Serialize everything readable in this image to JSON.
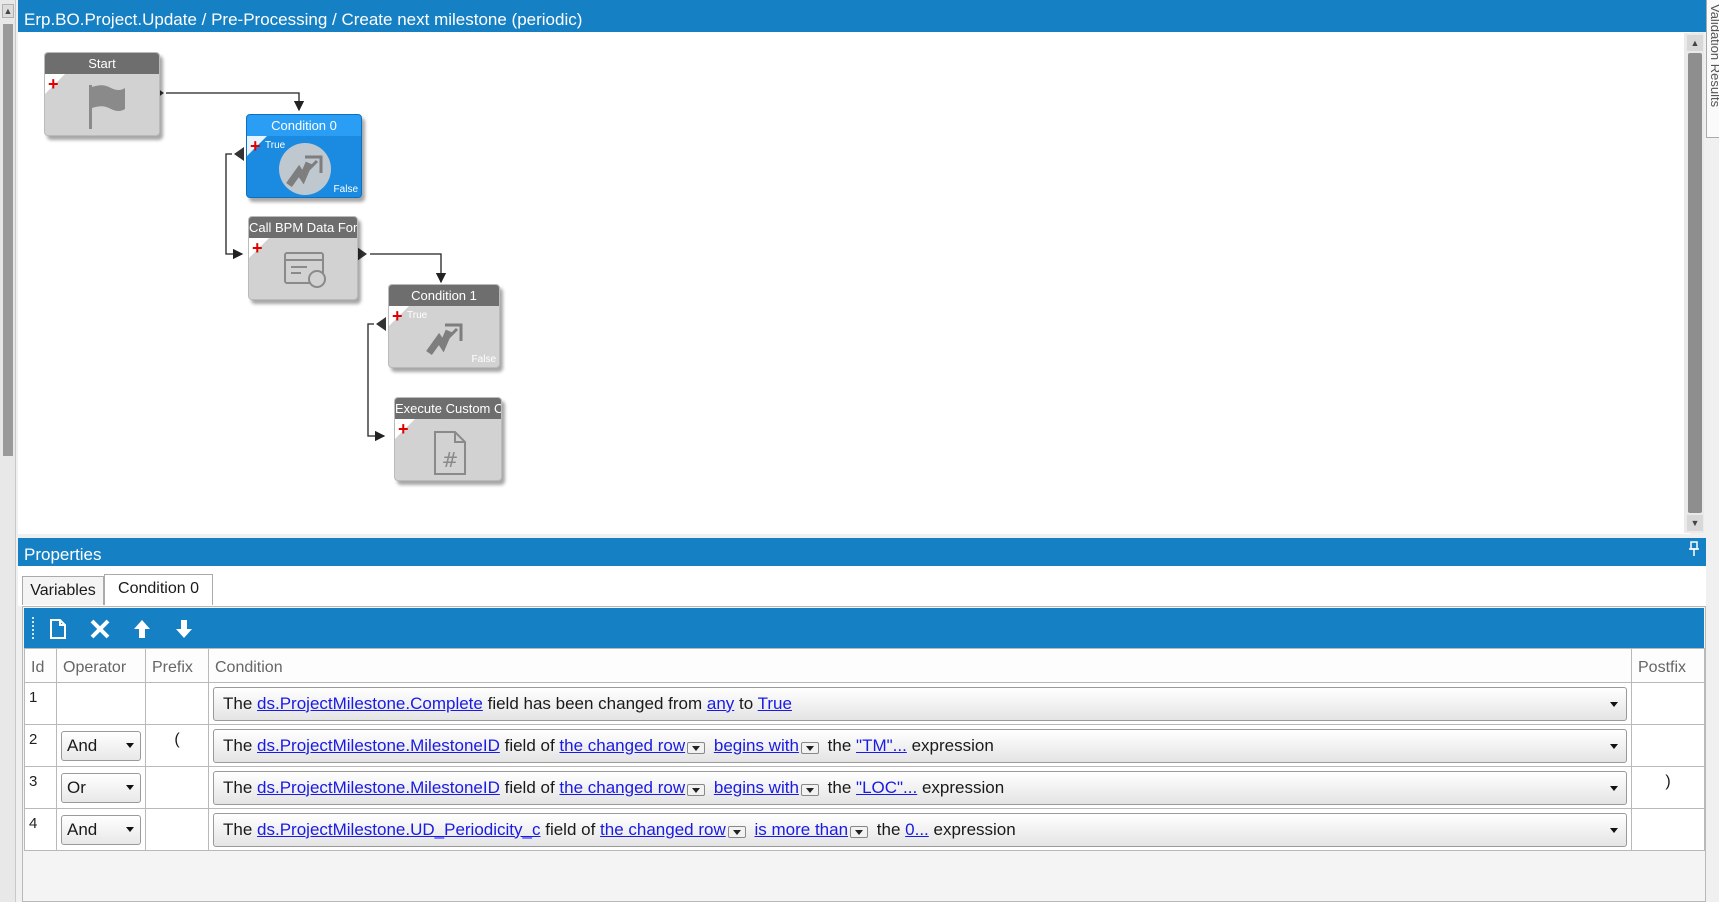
{
  "designer": {
    "breadcrumb": "Erp.BO.Project.Update / Pre-Processing / Create next milestone (periodic)",
    "side_tab_label": "Validation Results",
    "nodes": {
      "start": {
        "title": "Start"
      },
      "condition0": {
        "title": "Condition 0",
        "true_label": "True",
        "false_label": "False"
      },
      "call_bpm": {
        "title": "Call BPM Data Form"
      },
      "condition1": {
        "title": "Condition 1",
        "true_label": "True",
        "false_label": "False"
      },
      "execute_custom": {
        "title": "Execute Custom Code"
      }
    }
  },
  "properties": {
    "header": "Properties",
    "pin_icon": "pin-icon",
    "tabs": [
      {
        "label": "Variables"
      },
      {
        "label": "Condition 0",
        "active": true
      }
    ],
    "toolbar": [
      "new-doc-icon",
      "delete-icon",
      "move-up-icon",
      "move-down-icon"
    ],
    "columns": {
      "id": "Id",
      "operator": "Operator",
      "prefix": "Prefix",
      "condition": "Condition",
      "postfix": "Postfix"
    },
    "rows": [
      {
        "id": "1",
        "operator": "",
        "prefix": "",
        "postfix": "",
        "cond": {
          "p1": "The",
          "field": "ds.ProjectMilestone.Complete",
          "p2": "field has been changed from",
          "from": "any",
          "p3": "to",
          "to": "True"
        }
      },
      {
        "id": "2",
        "operator": "And",
        "prefix": "(",
        "postfix": "",
        "cond": {
          "p1": "The",
          "field": "ds.ProjectMilestone.MilestoneID",
          "p2": "field of",
          "row": "the changed row",
          "op": "begins with",
          "p3": "the",
          "value": "\"TM\"...",
          "p4": "expression"
        }
      },
      {
        "id": "3",
        "operator": "Or",
        "prefix": "",
        "postfix": ")",
        "cond": {
          "p1": "The",
          "field": "ds.ProjectMilestone.MilestoneID",
          "p2": "field of",
          "row": "the changed row",
          "op": "begins with",
          "p3": "the",
          "value": "\"LOC\"...",
          "p4": "expression"
        }
      },
      {
        "id": "4",
        "operator": "And",
        "prefix": "",
        "postfix": "",
        "cond": {
          "p1": "The",
          "field": "ds.ProjectMilestone.UD_Periodicity_c",
          "p2": "field of",
          "row": "the changed row",
          "op": "is more than",
          "p3": "the",
          "value": "0...",
          "p4": "expression"
        }
      }
    ]
  },
  "colors": {
    "accent": "#1580c4",
    "selected_node": "#1a8be0",
    "link": "#1a1ae6",
    "plus": "#e00000"
  }
}
